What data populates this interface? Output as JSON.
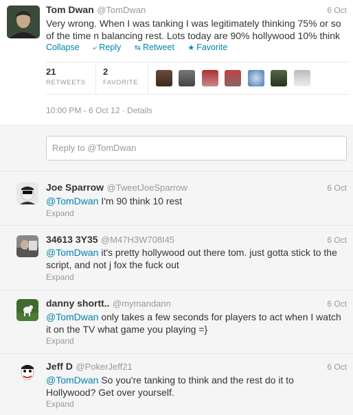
{
  "main_tweet": {
    "name": "Tom Dwan",
    "handle": "@TomDwan",
    "date": "6 Oct",
    "text_line1": "Very wrong. When I was tanking I was legitimately thinking 75% or so",
    "text_line2": "of the time n balancing rest. Lots today are 90% hollywood 10% think",
    "actions": {
      "collapse": "Collapse",
      "reply": "Reply",
      "retweet": "Retweet",
      "favorite": "Favorite"
    },
    "stats": {
      "retweets_count": "21",
      "retweets_label": "RETWEETS",
      "favorites_count": "2",
      "favorites_label": "FAVORITE"
    },
    "timestamp": "10:00 PM - 6 Oct 12 · Details"
  },
  "reply_box": {
    "placeholder": "Reply to @TomDwan"
  },
  "replies": [
    {
      "name": "Joe Sparrow",
      "handle": "@TweetJoeSparrow",
      "date": "6 Oct",
      "mention": "@TomDwan",
      "text_line1": " I'm 90 think 10 rest",
      "text_line2": "",
      "expand": "Expand"
    },
    {
      "name": "34613 3Y35",
      "handle": "@M47H3W708I45",
      "date": "6 Oct",
      "mention": "@TomDwan",
      "text_line1": " it's pretty hollywood out there tom. just gotta stick to the",
      "text_line2": "script, and not j fox the fuck out",
      "expand": "Expand"
    },
    {
      "name": "danny shortt..",
      "handle": "@mymandann",
      "date": "6 Oct",
      "mention": "@TomDwan",
      "text_line1": " only takes a few seconds for players to act when I watch",
      "text_line2": "it on the TV what game you playing =}",
      "expand": "Expand"
    },
    {
      "name": "Jeff D",
      "handle": "@PokerJeff21",
      "date": "6 Oct",
      "mention": "@TomDwan",
      "text_line1": " So you're tanking to think and the rest do it to",
      "text_line2": "Hollywood? Get over yourself.",
      "expand": "Expand"
    }
  ],
  "colors": {
    "link": "#0084b4",
    "muted": "#999999",
    "text": "#333333",
    "reply_bg": "#f5f5f5"
  },
  "icons": {
    "reply": "reply-arrow-icon",
    "retweet": "retweet-icon",
    "favorite": "star-icon"
  }
}
